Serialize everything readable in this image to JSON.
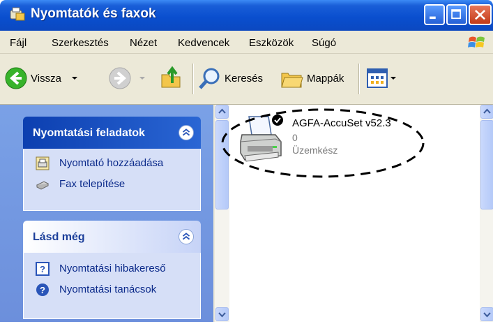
{
  "window": {
    "title": "Nyomtatók és faxok"
  },
  "menu": [
    "Fájl",
    "Szerkesztés",
    "Nézet",
    "Kedvencek",
    "Eszközök",
    "Súgó"
  ],
  "toolbar": {
    "back_label": "Vissza",
    "search_label": "Keresés",
    "folders_label": "Mappák"
  },
  "tasks_panel": {
    "title": "Nyomtatási feladatok",
    "items": [
      {
        "label": "Nyomtató hozzáadása",
        "icon": "add-printer-icon"
      },
      {
        "label": "Fax telepítése",
        "icon": "fax-icon"
      }
    ]
  },
  "see_also_panel": {
    "title": "Lásd még",
    "items": [
      {
        "label": "Nyomtatási hibakereső",
        "icon": "help-icon"
      },
      {
        "label": "Nyomtatási tanácsok",
        "icon": "question-circle-icon"
      }
    ]
  },
  "printer": {
    "name": "AGFA-AccuSet v52.3",
    "documents": "0",
    "status": "Üzemkész"
  },
  "colors": {
    "title_bar": "#0a4fcf",
    "task_pane": "#7aa1e6",
    "panel_body": "#d6dff7",
    "link": "#0b2a8a"
  }
}
